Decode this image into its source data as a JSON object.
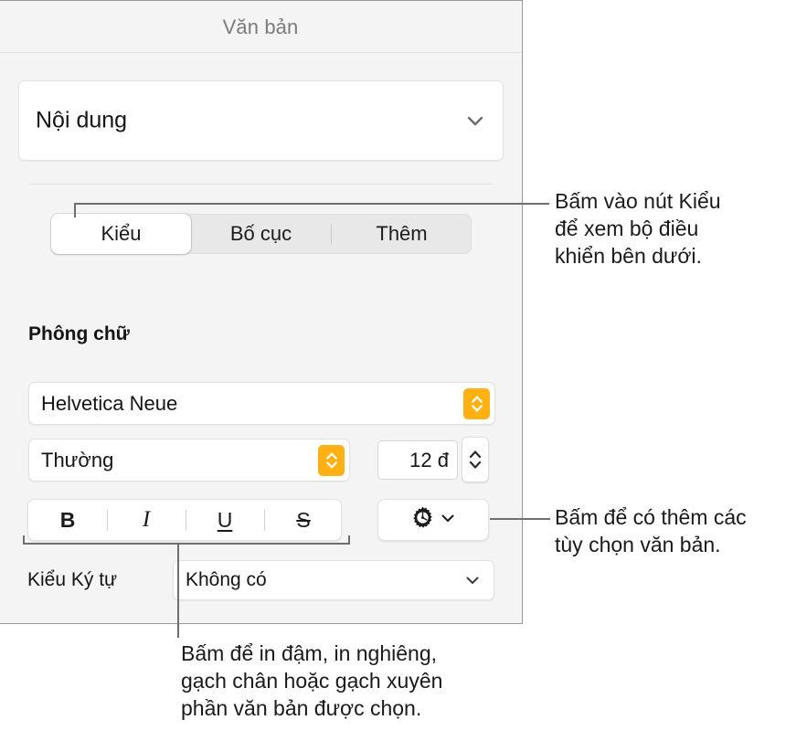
{
  "panel": {
    "title": "Văn bản",
    "content_popup": {
      "value": "Nội dung",
      "icon": "chevron-down-icon"
    },
    "segmented_control": {
      "items": [
        {
          "label": "Kiểu",
          "selected": true
        },
        {
          "label": "Bố cục",
          "selected": false
        },
        {
          "label": "Thêm",
          "selected": false
        }
      ]
    },
    "font_section": {
      "heading": "Phông chữ",
      "font_family": {
        "value": "Helvetica Neue",
        "icon": "up-down-chevrons-icon"
      },
      "font_style": {
        "value": "Thường",
        "icon": "up-down-chevrons-icon"
      },
      "font_size": {
        "value": "12 đ",
        "stepper_icon": "up-down-chevrons-icon"
      },
      "text_styles": [
        {
          "label": "B",
          "name": "bold"
        },
        {
          "label": "I",
          "name": "italic"
        },
        {
          "label": "U",
          "name": "underline"
        },
        {
          "label": "S",
          "name": "strikethrough"
        }
      ],
      "text_options_button": {
        "icon": "gear-icon",
        "chevron": "chevron-down-icon"
      },
      "character_style": {
        "label": "Kiểu Ký tự",
        "value": "Không có",
        "icon": "chevron-down-icon"
      }
    }
  },
  "callouts": {
    "style_button": "Bấm vào nút Kiểu\nđể xem bộ điều\nkhiển bên dưới.",
    "text_options": "Bấm để có thêm các\ntùy chọn văn bản.",
    "format_buttons": "Bấm để in đậm, in nghiêng,\ngạch chân hoặc gạch xuyên\nphần văn bản được chọn."
  },
  "colors": {
    "accent_orange": "#ffb113",
    "panel_background": "#f4f4f4",
    "panel_border": "#9a9a9a",
    "leader_line": "#6f6f6f",
    "title_text": "#7b7b7b"
  }
}
